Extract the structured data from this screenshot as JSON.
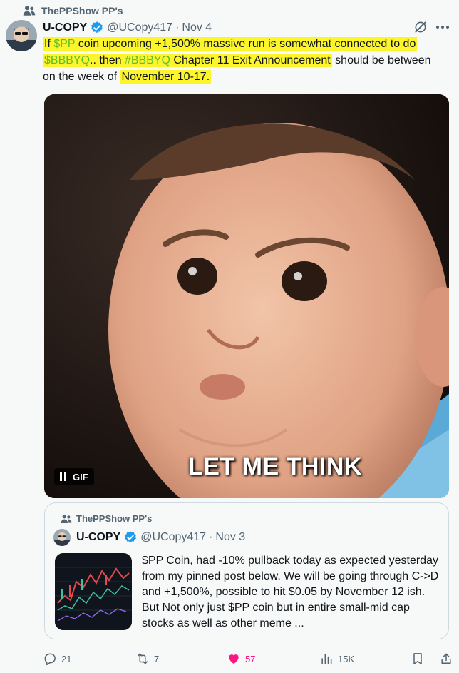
{
  "context": {
    "text": "ThePPShow PP's"
  },
  "tweet": {
    "name": "U-COPY",
    "handle": "@UCopy417",
    "separator": "·",
    "date": "Nov 4",
    "text_parts": {
      "p1": "If ",
      "p2": "$PP",
      "p3": " coin upcoming +1,500% massive run is somewhat connected to do",
      "p4": "$BBBYQ",
      "p5": ".. then ",
      "p6": "#BBBYQ",
      "p7": " Chapter 11 Exit Announcement",
      "p8": " should be between",
      "p9": "on the week of ",
      "p10": "November 10-17",
      "p11": "."
    }
  },
  "media": {
    "badge": "GIF",
    "caption": "LET ME THINK"
  },
  "quote": {
    "context": "ThePPShow PP's",
    "name": "U-COPY",
    "handle": "@UCopy417",
    "separator": "·",
    "date": "Nov 3",
    "text": "$PP Coin, had -10% pullback today as expected yesterday from my pinned post below. We will be going through C->D and +1,500%, possible to hit $0.05 by November 12 ish. But Not only just $PP coin but in entire small-mid cap stocks as well as other meme ..."
  },
  "actions": {
    "replies": "21",
    "reposts": "7",
    "likes": "57",
    "views": "15K"
  },
  "colors": {
    "accent_green": "#5bbf2a",
    "highlight": "#fcf52c",
    "like_pink": "#f91880",
    "verified_blue": "#1d9bf0"
  }
}
